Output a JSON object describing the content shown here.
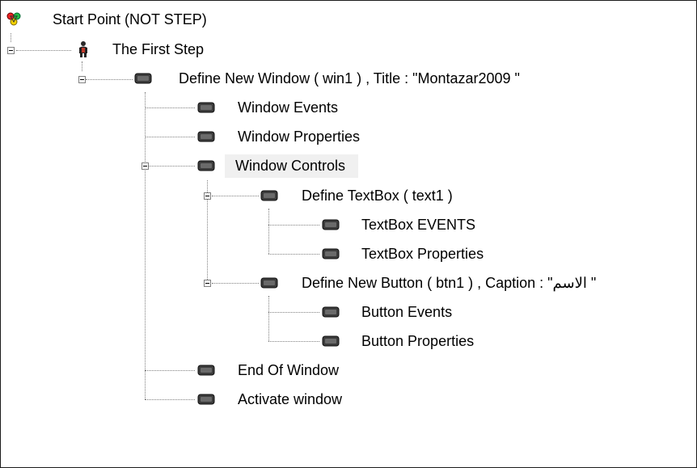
{
  "tree": {
    "root": {
      "label": "Start Point (NOT STEP)",
      "icon": "start-point-icon"
    },
    "first_step": {
      "label": "The First Step",
      "icon": "step-person-icon"
    },
    "define_window": {
      "label": "Define New Window  ( win1 ) , Title : \"Montazar2009  \"",
      "icon": "window-node-icon"
    },
    "window_events": {
      "label": "Window Events",
      "icon": "window-node-icon"
    },
    "window_properties": {
      "label": "Window Properties",
      "icon": "window-node-icon"
    },
    "window_controls": {
      "label": "Window Controls",
      "icon": "window-node-icon",
      "selected": true
    },
    "define_textbox": {
      "label": "Define TextBox  ( text1  )",
      "icon": "window-node-icon"
    },
    "textbox_events": {
      "label": "TextBox EVENTS",
      "icon": "window-node-icon"
    },
    "textbox_properties": {
      "label": "TextBox Properties",
      "icon": "window-node-icon"
    },
    "define_button": {
      "label": "Define New Button ( btn1 ) , Caption : \"الاسم \"",
      "icon": "window-node-icon"
    },
    "button_events": {
      "label": "Button Events",
      "icon": "window-node-icon"
    },
    "button_properties": {
      "label": "Button Properties",
      "icon": "window-node-icon"
    },
    "end_of_window": {
      "label": "End Of Window",
      "icon": "window-node-icon"
    },
    "activate_window": {
      "label": "Activate window",
      "icon": "window-node-icon"
    }
  },
  "colors": {
    "selection_background": "#f0f0f0",
    "connector_lines": "#808080",
    "node_icon": "#404040"
  }
}
